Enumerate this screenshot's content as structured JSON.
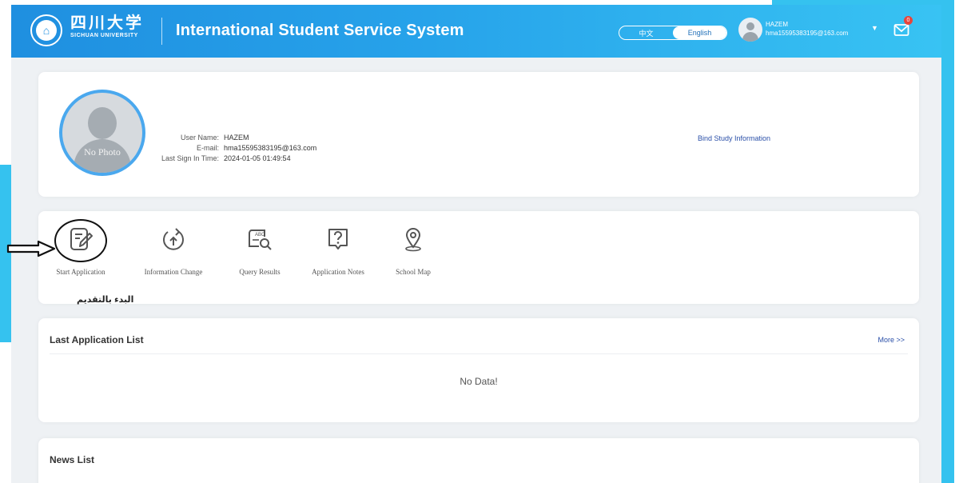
{
  "header": {
    "logo_cn": "四川大学",
    "logo_en": "SICHUAN UNIVERSITY",
    "title": "International Student Service System",
    "lang_options": [
      "中文",
      "English"
    ],
    "lang_active": "English",
    "user_name": "HAZEM",
    "user_email": "hma15595383195@163.com",
    "mail_badge": "0"
  },
  "profile": {
    "photo_placeholder": "No Photo",
    "fields": [
      {
        "label": "User Name:",
        "value": "HAZEM"
      },
      {
        "label": "E-mail:",
        "value": "hma15595383195@163.com"
      },
      {
        "label": "Last Sign In Time:",
        "value": "2024-01-05 01:49:54"
      }
    ],
    "bind_link": "Bind Study Information"
  },
  "actions": [
    {
      "label": "Start Application",
      "icon": "edit-icon"
    },
    {
      "label": "Information Change",
      "icon": "refresh-up-icon"
    },
    {
      "label": "Query Results",
      "icon": "query-results-icon"
    },
    {
      "label": "Application Notes",
      "icon": "question-icon"
    },
    {
      "label": "School Map",
      "icon": "location-pin-icon"
    }
  ],
  "annotation_arabic": "البدء بالتقديم",
  "last_application": {
    "title": "Last Application List",
    "more": "More >>",
    "empty": "No Data!"
  },
  "news": {
    "title": "News List"
  },
  "colors": {
    "header_start": "#1f8fe0",
    "header_end": "#38c3f3",
    "accent_ring": "#4aa8ee",
    "frame": "#35c2ef",
    "link": "#2a4fa8"
  }
}
